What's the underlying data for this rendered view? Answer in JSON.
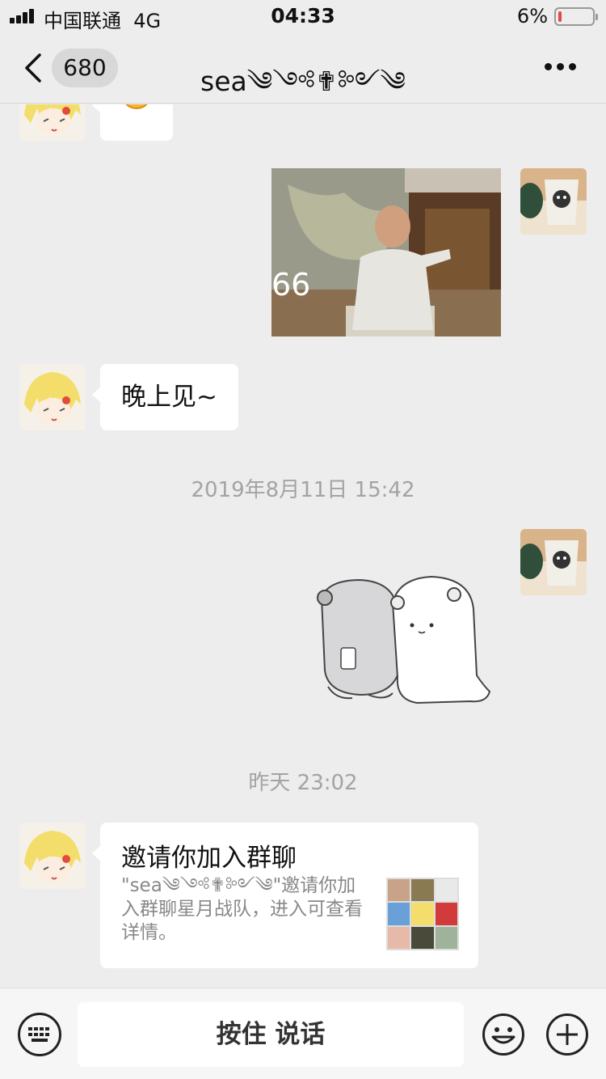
{
  "status_bar": {
    "carrier": "中国联通",
    "network": "4G",
    "time": "04:33",
    "battery_percent": "6%",
    "battery_level": 0.06
  },
  "nav": {
    "back_count": "680",
    "title": "sea༄༺✟༻༄"
  },
  "messages": [
    {
      "type": "emoji",
      "side": "left",
      "emoji_icon": "smiley-icon"
    },
    {
      "type": "image",
      "side": "right",
      "overlay_text": "66"
    },
    {
      "type": "text",
      "side": "left",
      "text": "晚上见~"
    },
    {
      "type": "timestamp",
      "text": "2019年8月11日 15:42"
    },
    {
      "type": "sticker",
      "side": "right",
      "sticker_icon": "hamster-sticker"
    },
    {
      "type": "timestamp",
      "text": "昨天 23:02"
    },
    {
      "type": "card",
      "side": "left",
      "title": "邀请你加入群聊",
      "description": "\"sea༄༺✟༻༄\"邀请你加入群聊星月战队，进入可查看详情。"
    }
  ],
  "bottom_bar": {
    "voice_button_label": "按住 说话",
    "icons": [
      "keyboard-icon",
      "emoji-icon",
      "plus-icon"
    ]
  },
  "colors": {
    "background": "#ededed",
    "bubble": "#ffffff",
    "battery_low": "#e24a3c",
    "timestamp_text": "#a3a3a3"
  }
}
